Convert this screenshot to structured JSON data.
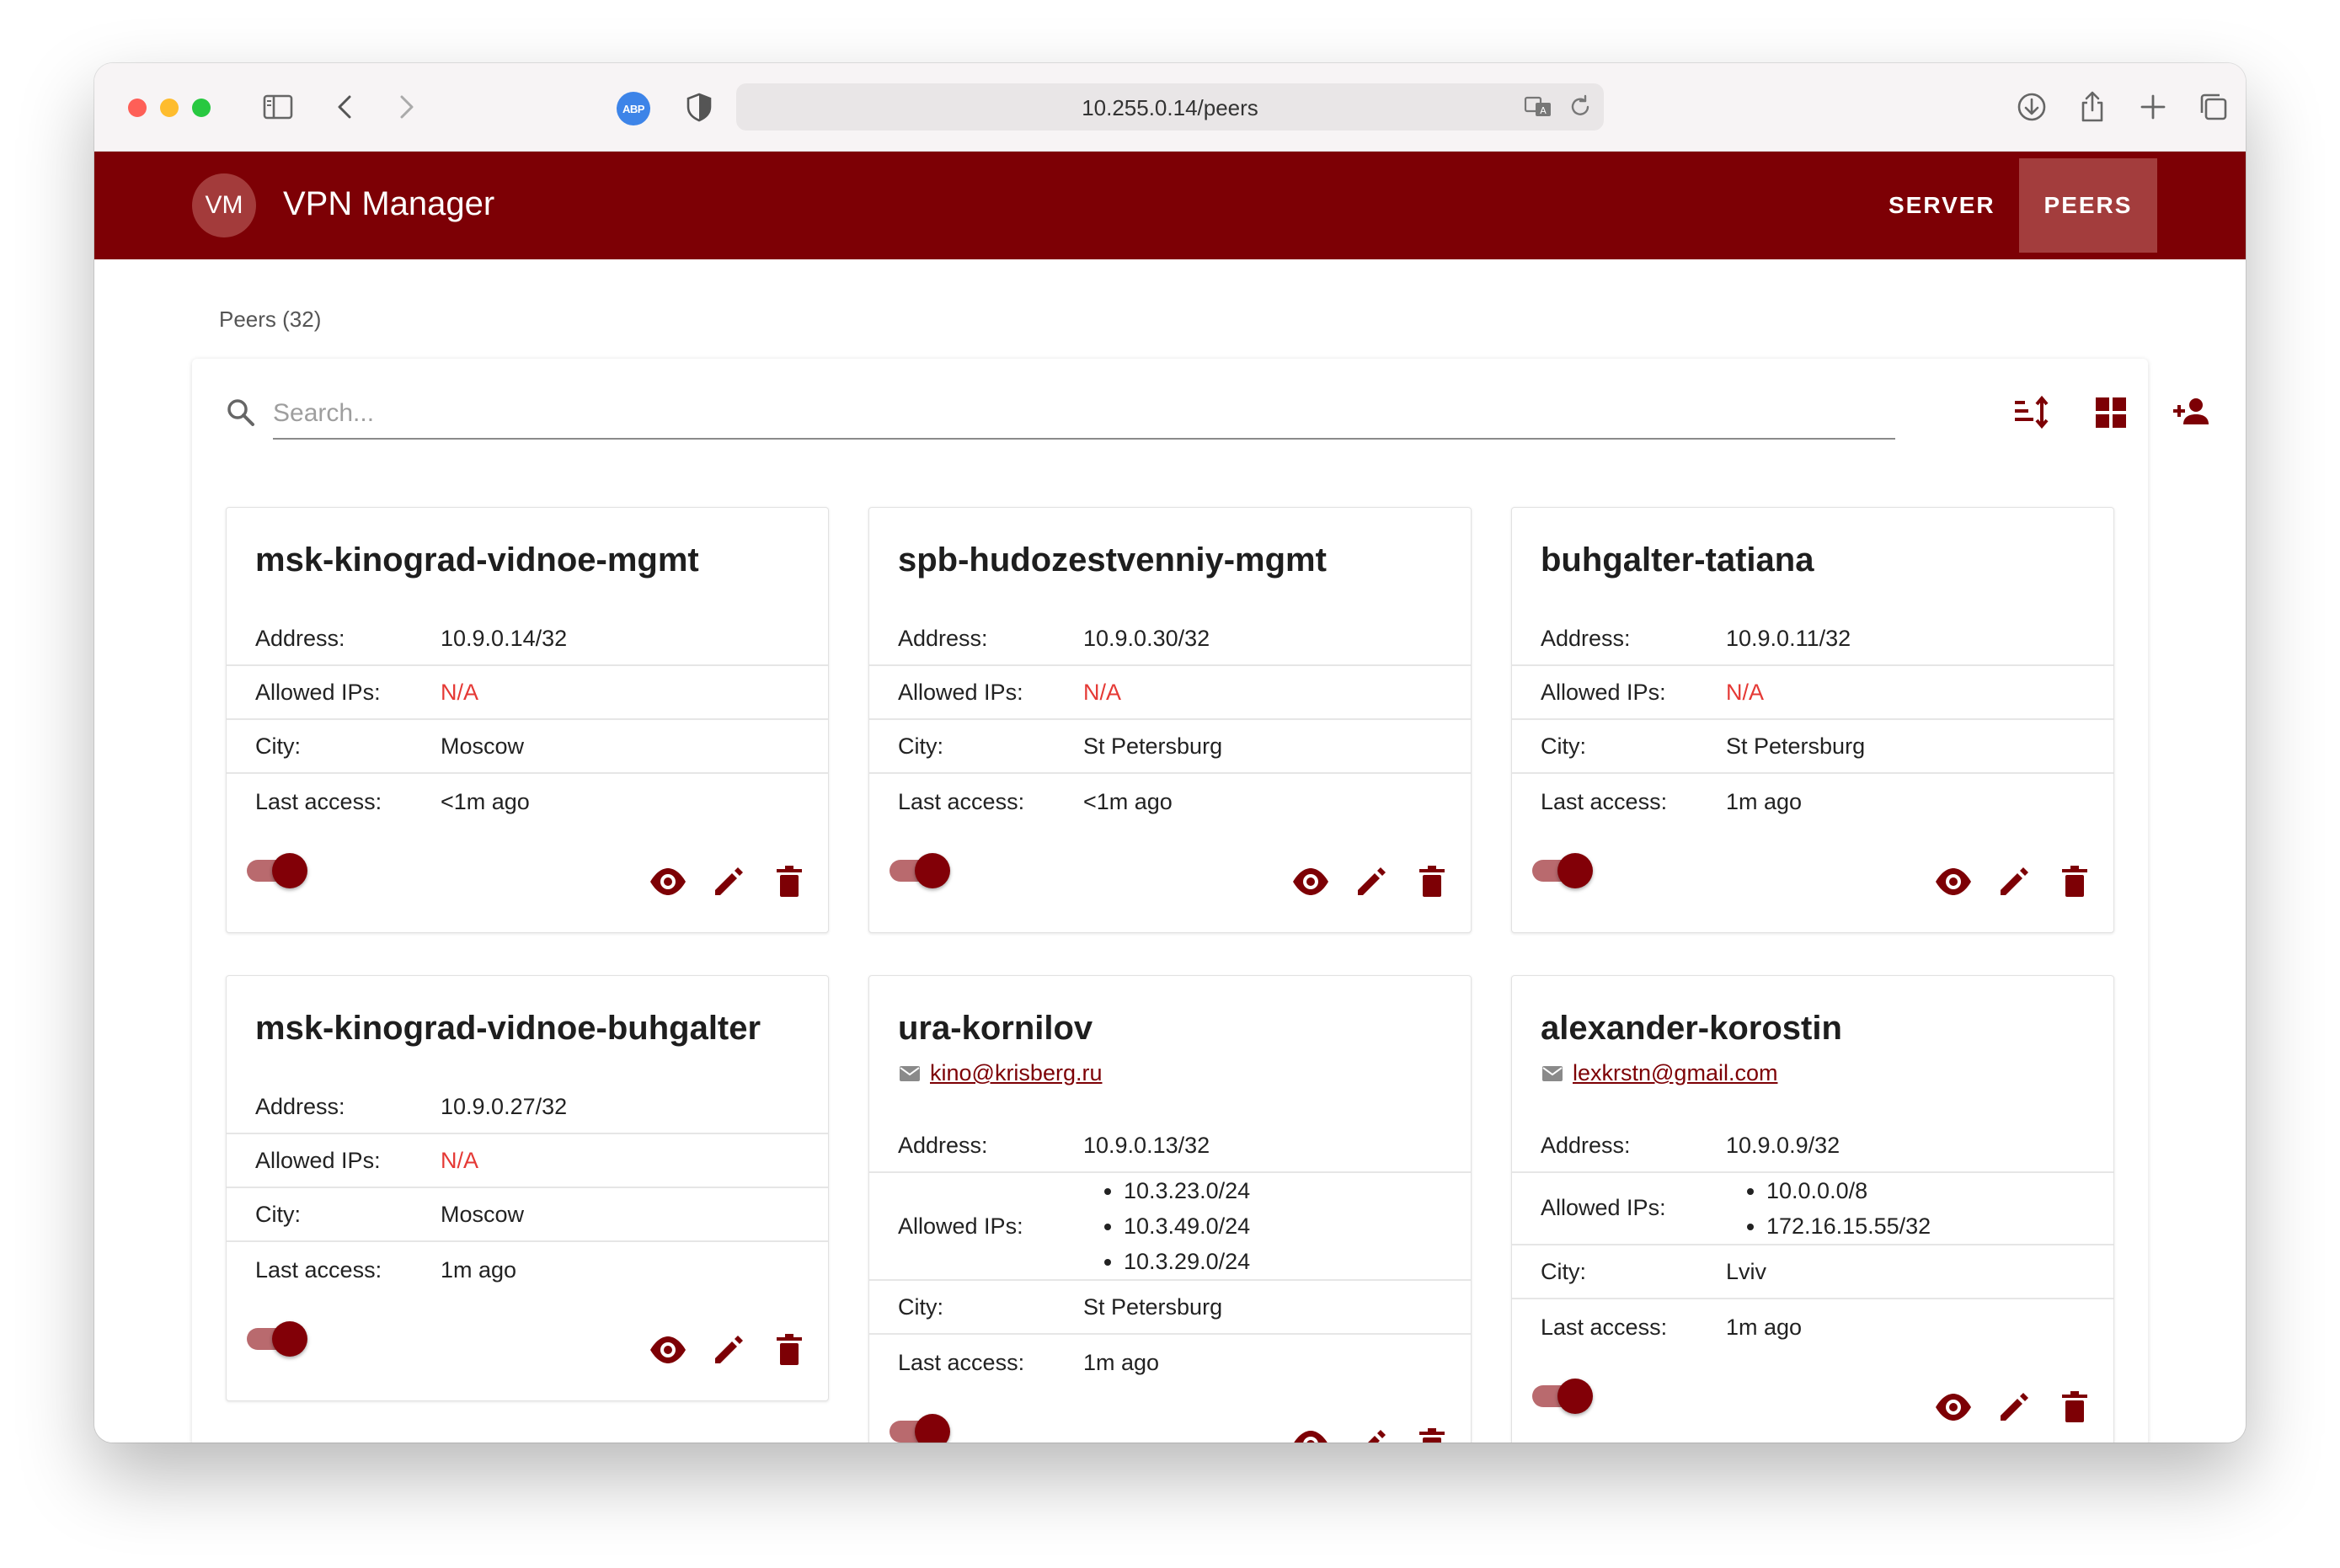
{
  "browser": {
    "url": "10.255.0.14/peers",
    "adblock_label": "ABP",
    "icons": [
      "sidebar-icon",
      "back-icon",
      "forward-icon",
      "adblock-icon",
      "privacy-shield-icon",
      "translate-icon",
      "reload-icon",
      "download-icon",
      "share-icon",
      "new-tab-icon",
      "tabs-overview-icon"
    ]
  },
  "app": {
    "avatar": "VM",
    "title": "VPN Manager",
    "nav": {
      "server": "SERVER",
      "peers": "PEERS"
    },
    "colors": {
      "primary": "#7d0005",
      "active_nav": "#a33d3d",
      "na": "#e53935"
    }
  },
  "page": {
    "title": "Peers (32)"
  },
  "search": {
    "placeholder": "Search..."
  },
  "toolbar_icons": [
    "sort-icon",
    "grid-view-icon",
    "add-peer-icon"
  ],
  "labels": {
    "address": "Address:",
    "allowed": "Allowed IPs:",
    "city": "City:",
    "last": "Last access:"
  },
  "peers": [
    {
      "name": "msk-kinograd-vidnoe-mgmt",
      "address": "10.9.0.14/32",
      "allowed": "N/A",
      "city": "Moscow",
      "last": "<1m ago",
      "enabled": true
    },
    {
      "name": "spb-hudozestvenniy-mgmt",
      "address": "10.9.0.30/32",
      "allowed": "N/A",
      "city": "St Petersburg",
      "last": "<1m ago",
      "enabled": true
    },
    {
      "name": "buhgalter-tatiana",
      "address": "10.9.0.11/32",
      "allowed": "N/A",
      "city": "St Petersburg",
      "last": "1m ago",
      "enabled": true
    },
    {
      "name": "msk-kinograd-vidnoe-buhgalter",
      "address": "10.9.0.27/32",
      "allowed": "N/A",
      "city": "Moscow",
      "last": "1m ago",
      "enabled": true
    },
    {
      "name": "ura-kornilov",
      "email": "kino@krisberg.ru",
      "address": "10.9.0.13/32",
      "allowed_list": [
        "10.3.23.0/24",
        "10.3.49.0/24",
        "10.3.29.0/24"
      ],
      "city": "St Petersburg",
      "last": "1m ago",
      "enabled": true
    },
    {
      "name": "alexander-korostin",
      "email": "lexkrstn@gmail.com",
      "address": "10.9.0.9/32",
      "allowed_list": [
        "10.0.0.0/8",
        "172.16.15.55/32"
      ],
      "city": "Lviv",
      "last": "1m ago",
      "enabled": true
    }
  ]
}
